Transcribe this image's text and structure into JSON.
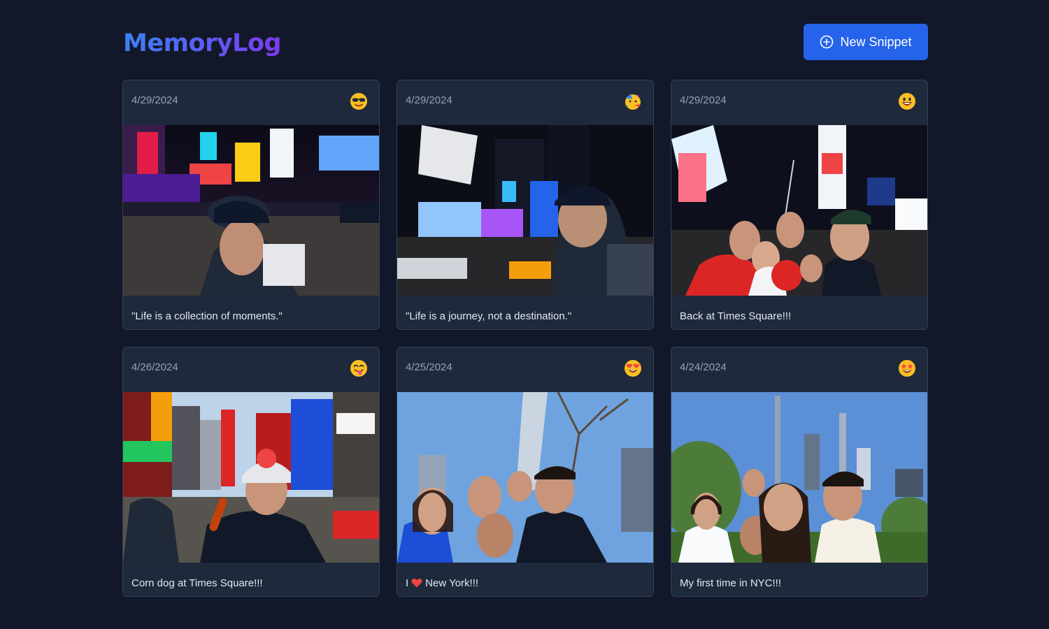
{
  "app": {
    "title": "MemoryLog",
    "new_button_label": "New Snippet",
    "new_button_icon": "plus-circle-icon",
    "accent": "#2563eb"
  },
  "snippets": [
    {
      "date": "4/29/2024",
      "mood": "smiling-face-with-sunglasses",
      "caption": "\"Life is a collection of moments.\"",
      "photo": "night-times-square-boy-cap"
    },
    {
      "date": "4/29/2024",
      "mood": "face-with-party-horn",
      "caption": "\"Life is a journey, not a destination.\"",
      "photo": "night-times-square-billboards"
    },
    {
      "date": "4/29/2024",
      "mood": "grinning-face",
      "caption": "Back at Times Square!!!",
      "photo": "night-times-square-family-selfie"
    },
    {
      "date": "4/26/2024",
      "mood": "face-with-tongue",
      "caption": "Corn dog at Times Square!!!",
      "photo": "day-times-square-corn-dog"
    },
    {
      "date": "4/25/2024",
      "mood": "smiling-face-with-heart-eyes",
      "caption_prefix": "I",
      "caption_suffix": "New York!!!",
      "caption_icon": "red-heart-icon",
      "photo": "family-selfie-one-world-trade"
    },
    {
      "date": "4/24/2024",
      "mood": "star-struck",
      "caption": "My first time in NYC!!!",
      "photo": "family-selfie-central-park"
    }
  ]
}
